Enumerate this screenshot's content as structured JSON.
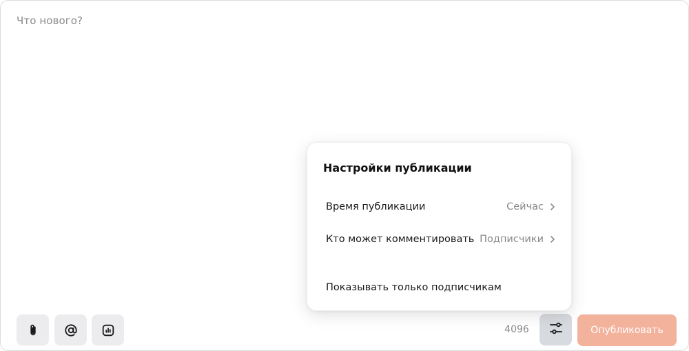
{
  "composer": {
    "placeholder": "Что нового?"
  },
  "toolbar": {
    "attach_icon": "paperclip-icon",
    "mention_icon": "at-sign-icon",
    "poll_icon": "poll-chart-icon",
    "char_counter": "4096",
    "settings_icon": "sliders-icon",
    "publish_label": "Опубликовать"
  },
  "settings_popup": {
    "title": "Настройки публикации",
    "rows": [
      {
        "label": "Время публикации",
        "value": "Сейчас"
      },
      {
        "label": "Кто может комментировать",
        "value": "Подписчики"
      },
      {
        "label": "Показывать только подписчикам"
      }
    ]
  },
  "colors": {
    "publish_button_bg": "#f3b29c",
    "tool_button_bg": "#ececef",
    "settings_button_active_bg": "#d7dade"
  }
}
